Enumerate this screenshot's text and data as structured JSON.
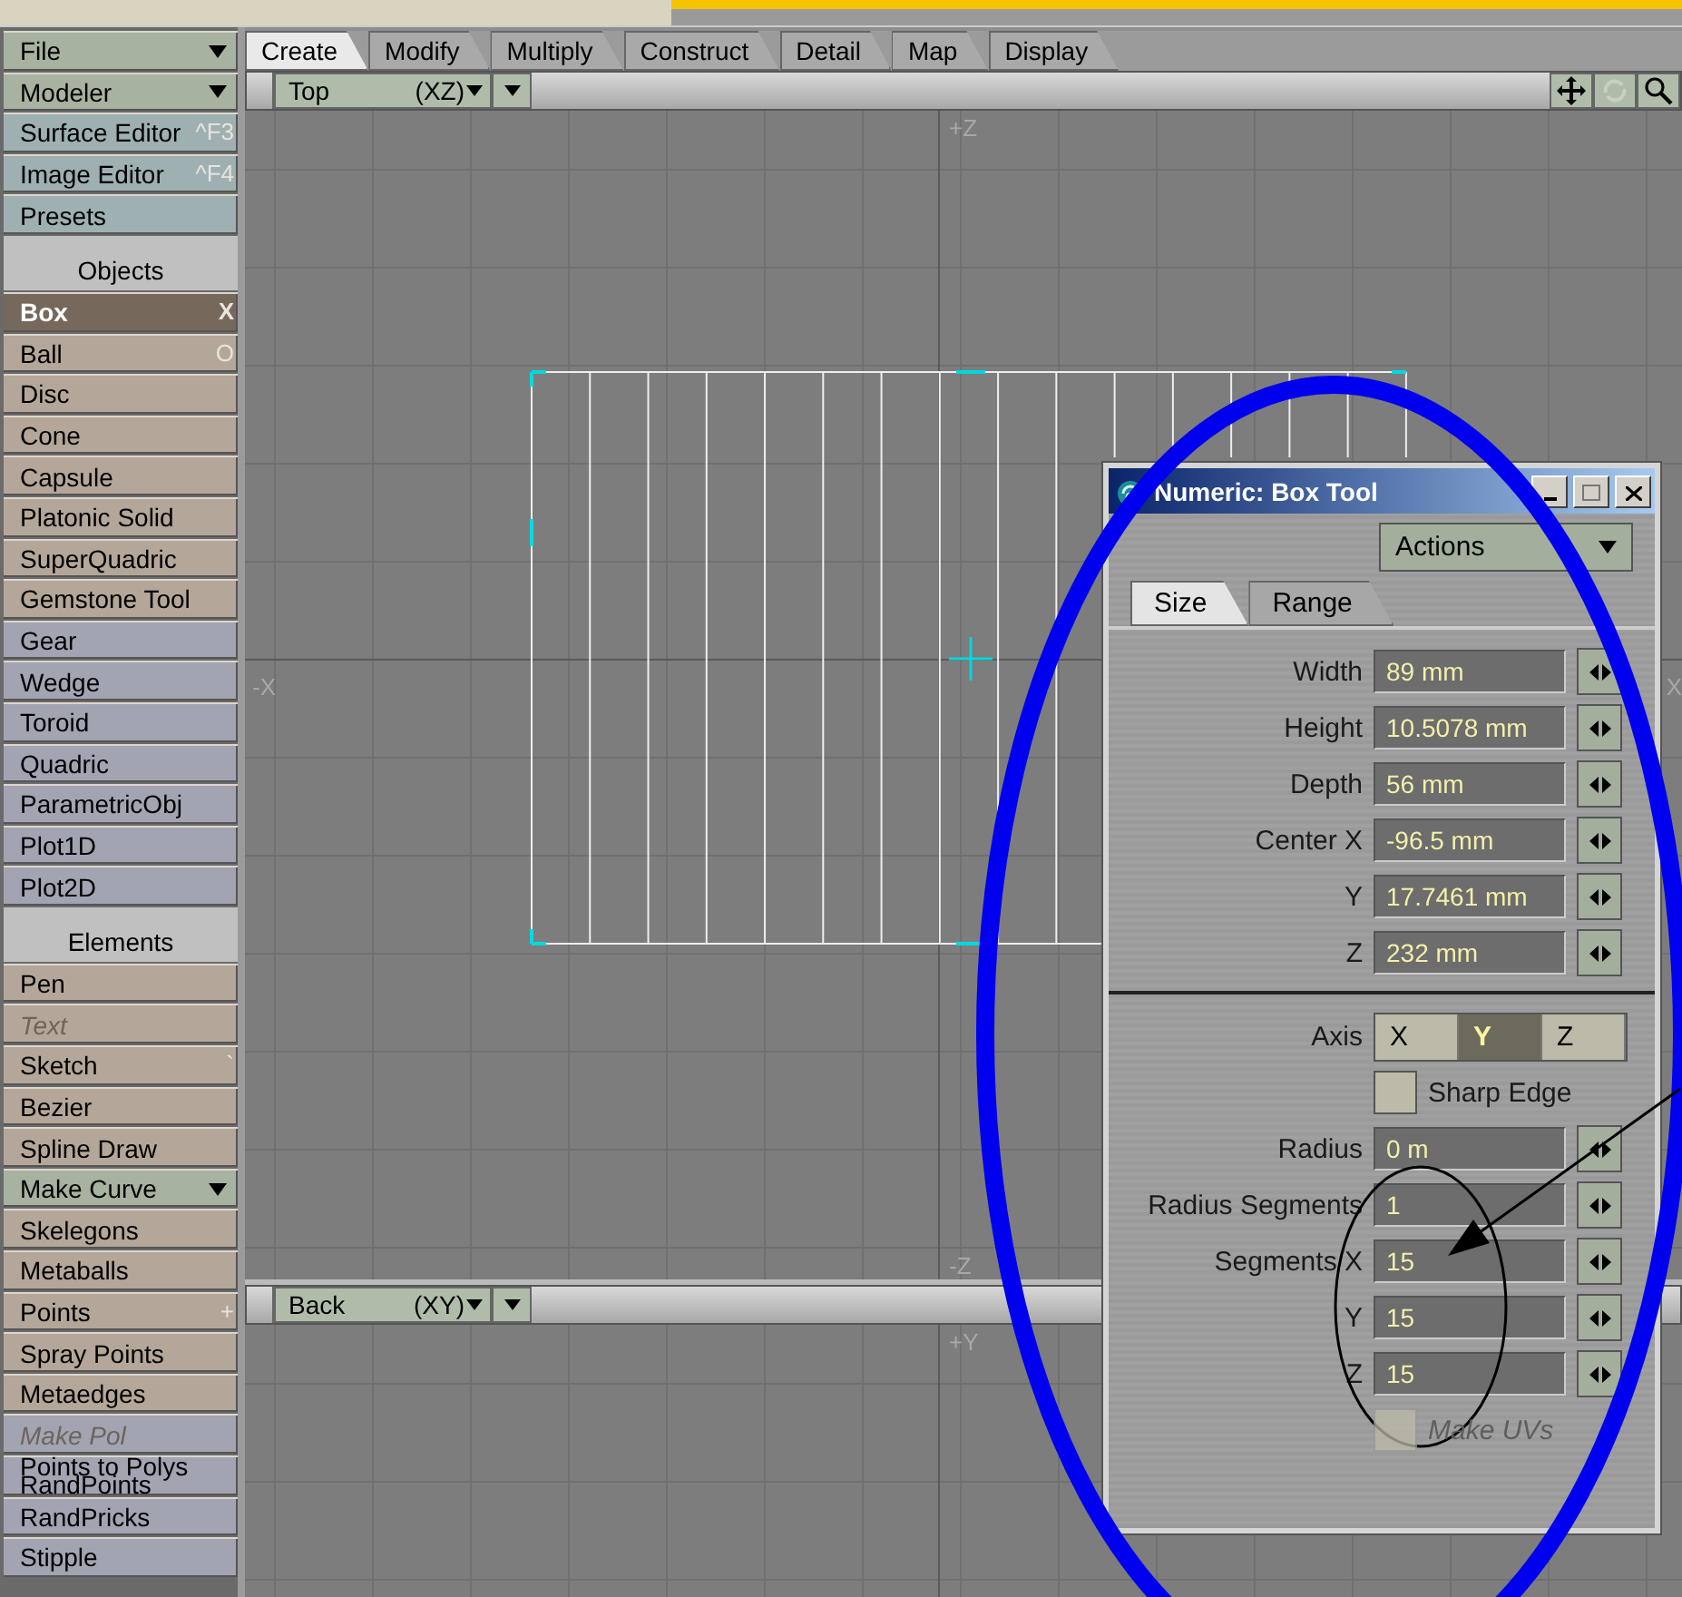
{
  "sidebar": [
    {
      "kind": "dropdown",
      "label": "File",
      "color": "#a8b2a0"
    },
    {
      "kind": "dropdown",
      "label": "Modeler",
      "color": "#a8b2a0"
    },
    {
      "kind": "button",
      "label": "Surface Editor",
      "shortcut": "^F3",
      "color": "#9fb0b2",
      "selected": false,
      "disabled": false
    },
    {
      "kind": "button",
      "label": "Image Editor",
      "shortcut": "^F4",
      "color": "#9fb0b2",
      "selected": false,
      "disabled": false
    },
    {
      "kind": "button",
      "label": "Presets",
      "color": "#9fb0b2",
      "selected": false,
      "disabled": false
    },
    {
      "kind": "section",
      "label": "Objects"
    },
    {
      "kind": "button",
      "label": "Box",
      "shortcut": "X",
      "selected": true,
      "disabled": false
    },
    {
      "kind": "button",
      "label": "Ball",
      "shortcut": "O",
      "color": "#b4a799",
      "selected": false,
      "disabled": false
    },
    {
      "kind": "button",
      "label": "Disc",
      "color": "#b4a799",
      "selected": false,
      "disabled": false
    },
    {
      "kind": "button",
      "label": "Cone",
      "color": "#b4a799",
      "selected": false,
      "disabled": false
    },
    {
      "kind": "button",
      "label": "Capsule",
      "color": "#b4a799",
      "selected": false,
      "disabled": false
    },
    {
      "kind": "button",
      "label": "Platonic Solid",
      "color": "#b4a799",
      "selected": false,
      "disabled": false
    },
    {
      "kind": "button",
      "label": "SuperQuadric",
      "color": "#b4a799",
      "selected": false,
      "disabled": false
    },
    {
      "kind": "button",
      "label": "Gemstone Tool",
      "color": "#b4a799",
      "selected": false,
      "disabled": false
    },
    {
      "kind": "button",
      "label": "Gear",
      "color": "#a2a4b2",
      "selected": false,
      "disabled": false
    },
    {
      "kind": "button",
      "label": "Wedge",
      "color": "#a2a4b2",
      "selected": false,
      "disabled": false
    },
    {
      "kind": "button",
      "label": "Toroid",
      "color": "#a2a4b2",
      "selected": false,
      "disabled": false
    },
    {
      "kind": "button",
      "label": "Quadric",
      "color": "#a2a4b2",
      "selected": false,
      "disabled": false
    },
    {
      "kind": "button",
      "label": "ParametricObj",
      "color": "#a2a4b2",
      "selected": false,
      "disabled": false
    },
    {
      "kind": "button",
      "label": "Plot1D",
      "color": "#a2a4b2",
      "selected": false,
      "disabled": false
    },
    {
      "kind": "button",
      "label": "Plot2D",
      "color": "#a2a4b2",
      "selected": false,
      "disabled": false
    },
    {
      "kind": "section",
      "label": "Elements"
    },
    {
      "kind": "button",
      "label": "Pen",
      "color": "#b4a799",
      "selected": false,
      "disabled": false
    },
    {
      "kind": "button",
      "label": "Text",
      "color": "#b4a799",
      "selected": false,
      "disabled": true
    },
    {
      "kind": "button",
      "label": "Sketch",
      "shortcut": "`",
      "color": "#b4a799",
      "selected": false,
      "disabled": false
    },
    {
      "kind": "button",
      "label": "Bezier",
      "color": "#b4a799",
      "selected": false,
      "disabled": false
    },
    {
      "kind": "button",
      "label": "Spline Draw",
      "color": "#b4a799",
      "selected": false,
      "disabled": false
    },
    {
      "kind": "dropdown",
      "label": "Make Curve",
      "color": "#a8b2a0"
    },
    {
      "kind": "button",
      "label": "Skelegons",
      "color": "#b4a799",
      "selected": false,
      "disabled": false
    },
    {
      "kind": "button",
      "label": "Metaballs",
      "color": "#b4a799",
      "selected": false,
      "disabled": false
    },
    {
      "kind": "button",
      "label": "Points",
      "shortcut": "+",
      "color": "#b4a799",
      "selected": false,
      "disabled": false
    },
    {
      "kind": "button",
      "label": "Spray Points",
      "color": "#b4a799",
      "selected": false,
      "disabled": false
    },
    {
      "kind": "button",
      "label": "Metaedges",
      "color": "#b4a799",
      "selected": false,
      "disabled": false
    },
    {
      "kind": "button",
      "label": "Make Pol",
      "color": "#a2a4b2",
      "selected": false,
      "disabled": true
    },
    {
      "kind": "button",
      "label": "Points to Polys",
      "overlap_label": "RandPoints",
      "color": "#a2a4b2",
      "selected": false,
      "disabled": false
    },
    {
      "kind": "button",
      "label": "RandPricks",
      "color": "#a2a4b2",
      "selected": false,
      "disabled": false
    },
    {
      "kind": "button",
      "label": "Stipple",
      "color": "#a2a4b2",
      "selected": false,
      "disabled": false
    }
  ],
  "tabs": [
    {
      "label": "Create",
      "selected": true
    },
    {
      "label": "Modify",
      "selected": false
    },
    {
      "label": "Multiply",
      "selected": false
    },
    {
      "label": "Construct",
      "selected": false
    },
    {
      "label": "Detail",
      "selected": false
    },
    {
      "label": "Map",
      "selected": false
    },
    {
      "label": "Display",
      "selected": false
    }
  ],
  "top_viewport": {
    "view": "Top",
    "plane": "(XZ)",
    "axis_labels": {
      "top": "+Z",
      "left": "-X",
      "right": "X",
      "bottom": "-Z"
    }
  },
  "back_viewport": {
    "view": "Back",
    "plane": "(XY)",
    "axis_labels": {
      "top": "+Y"
    }
  },
  "dialog": {
    "title": "Numeric: Box Tool",
    "actions": "Actions",
    "tabs": [
      {
        "label": "Size",
        "selected": true
      },
      {
        "label": "Range",
        "selected": false
      }
    ],
    "size_fields": [
      {
        "label": "Width",
        "value": "89 mm"
      },
      {
        "label": "Height",
        "value": "10.5078 mm"
      },
      {
        "label": "Depth",
        "value": "56 mm"
      },
      {
        "label": "Center X",
        "value": "-96.5 mm"
      },
      {
        "label": "Y",
        "value": "17.7461 mm"
      },
      {
        "label": "Z",
        "value": "232 mm"
      }
    ],
    "options": [
      {
        "kind": "axis",
        "label": "Axis",
        "choices": [
          {
            "label": "X",
            "selected": false
          },
          {
            "label": "Y",
            "selected": true
          },
          {
            "label": "Z",
            "selected": false
          }
        ]
      },
      {
        "kind": "checkbox",
        "label": "Sharp Edge",
        "checked": false,
        "disabled": false
      },
      {
        "kind": "field",
        "label": "Radius",
        "value": "0 m"
      },
      {
        "kind": "field",
        "label": "Radius Segments",
        "value": "1"
      },
      {
        "kind": "field",
        "label": "Segments X",
        "value": "15"
      },
      {
        "kind": "field",
        "label": "Y",
        "value": "15"
      },
      {
        "kind": "field",
        "label": "Z",
        "value": "15"
      },
      {
        "kind": "checkbox",
        "label": "Make UVs",
        "checked": false,
        "disabled": true
      }
    ]
  }
}
